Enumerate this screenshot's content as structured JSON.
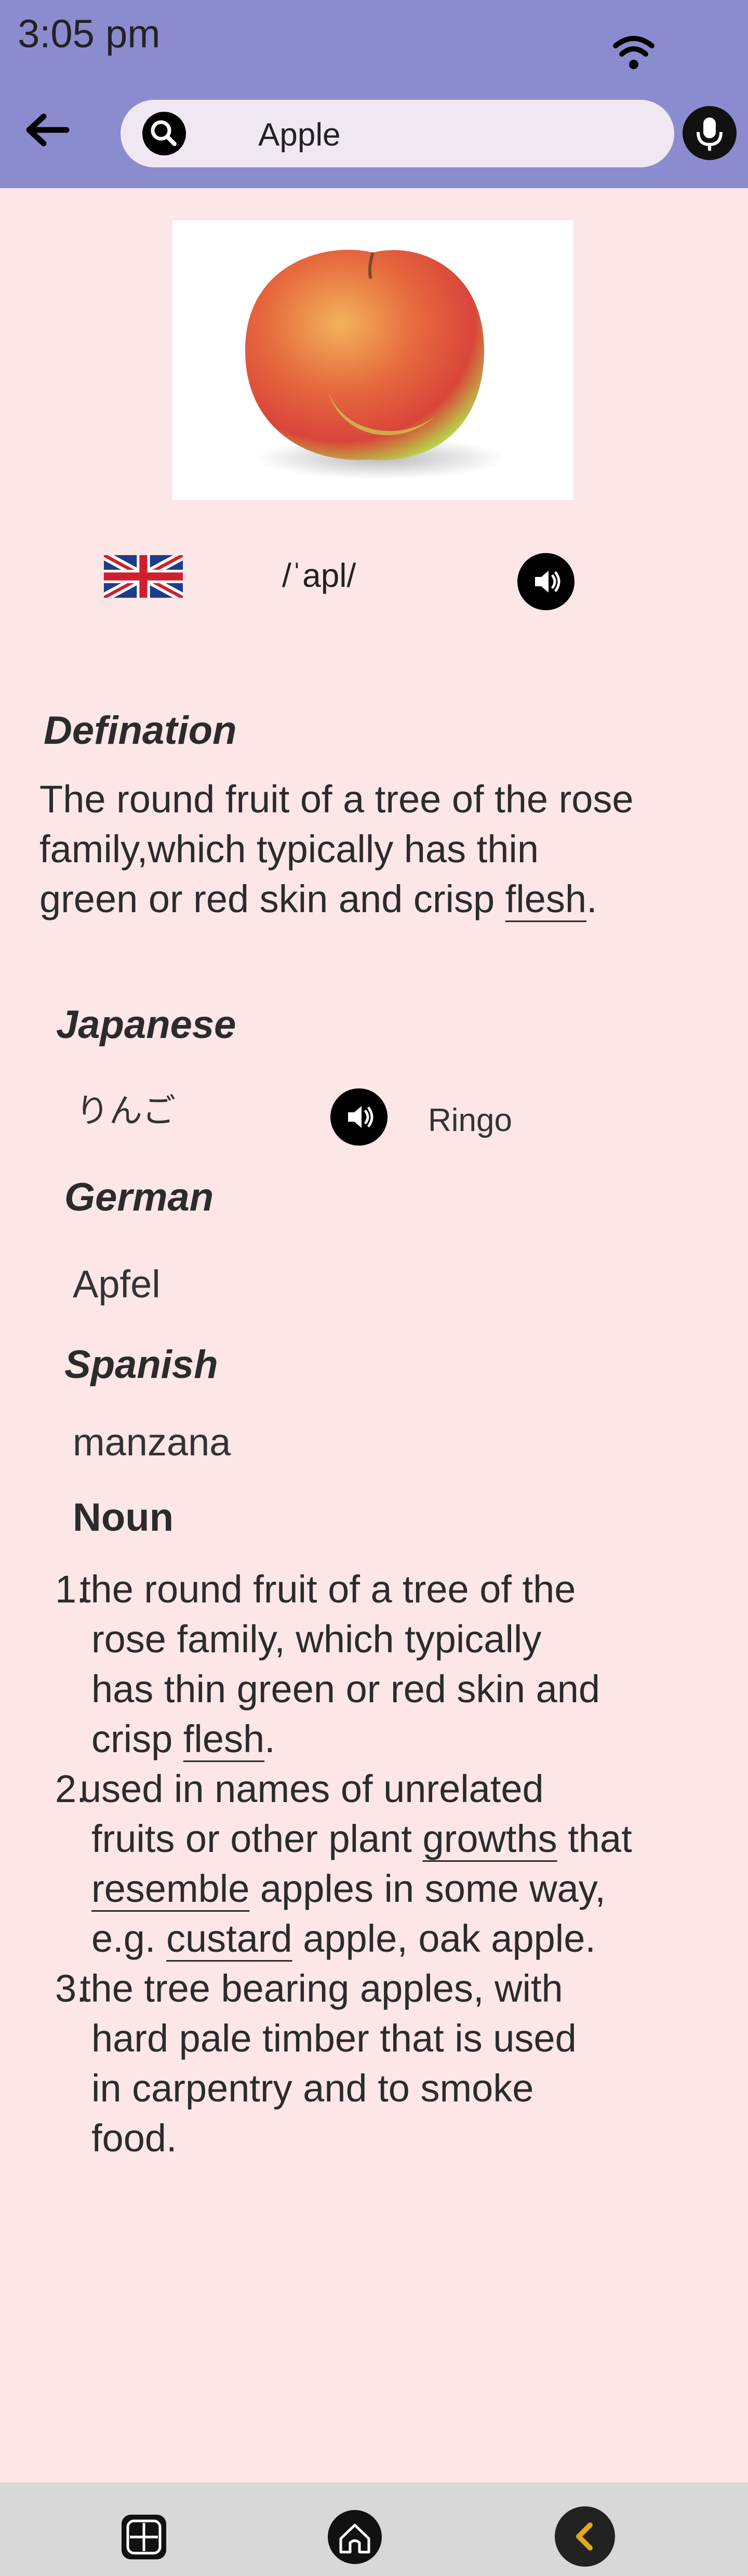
{
  "status": {
    "time": "3:05 pm"
  },
  "search": {
    "query": "Apple"
  },
  "word": {
    "phonetic": "/ˈapl/"
  },
  "definition": {
    "heading": "Defination",
    "lines": [
      "The round fruit of a tree of the rose",
      "family,which typically has thin",
      "green or red skin and crisp "
    ],
    "underlined": "flesh",
    "end": "."
  },
  "japanese": {
    "heading": "Japanese",
    "word": "りんご",
    "romaji": "Ringo"
  },
  "german": {
    "heading": "German",
    "word": "Apfel"
  },
  "spanish": {
    "heading": "Spanish",
    "word": "manzana"
  },
  "noun": {
    "heading": "Noun",
    "items": [
      {
        "num": "1.",
        "l1": "the round fruit of a tree of the",
        "l2": "rose family, which typically",
        "l3": "has thin green or red skin and",
        "l4a": "crisp ",
        "l4u": "flesh",
        "l4b": "."
      },
      {
        "num": "2.",
        "l1": "used in names of unrelated",
        "l2a": "fruits or other plant ",
        "l2u": "growths",
        "l2b": " that",
        "l3u": "resemble",
        "l3b": " apples in some way,",
        "l4a": "e.g. ",
        "l4u": "custard",
        "l4b": " apple, oak apple."
      },
      {
        "num": "3.",
        "l1": "the tree bearing apples, with",
        "l2": "hard pale timber that is used",
        "l3": "in carpentry and to smoke",
        "l4": "food."
      }
    ]
  },
  "colors": {
    "header": "#8b8ccf",
    "background": "#fce6e6",
    "navbar": "#d8d8d8",
    "accent": "#e0a81c"
  }
}
